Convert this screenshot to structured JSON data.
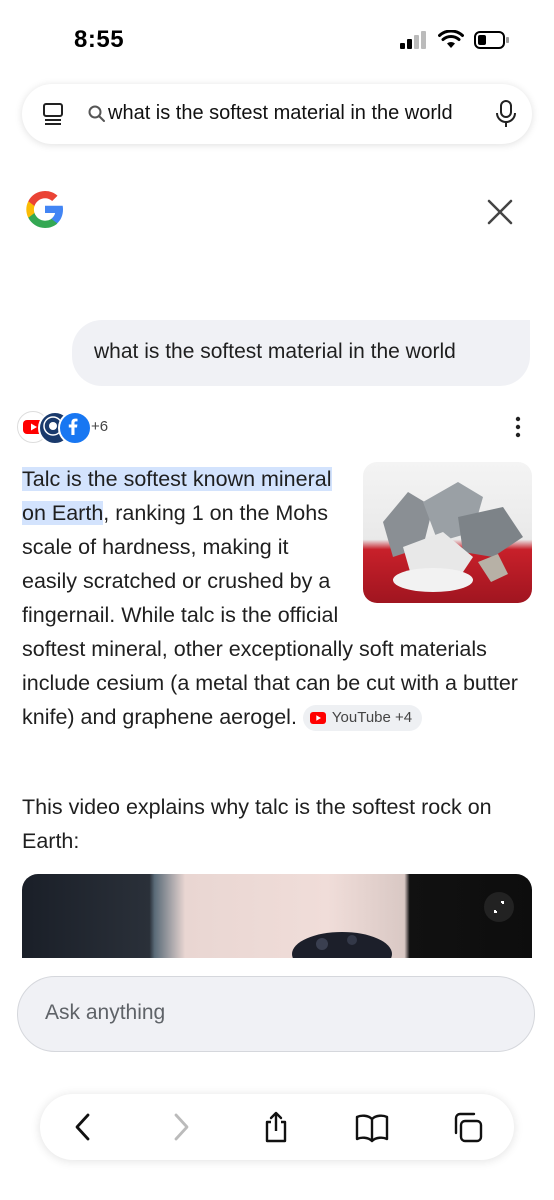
{
  "status": {
    "time": "8:55"
  },
  "urlbar": {
    "query": "what is the softest material in the world"
  },
  "conversation": {
    "user_query": "what is the softest material in the world",
    "sources_more": "+6",
    "answer": {
      "highlight": "Talc is the softest known mineral on Earth",
      "rest": ", ranking 1 on the Mohs scale of hardness, making it easily scratched or crushed by a fingernail. While talc is the official softest mineral, other exceptionally soft materials include cesium (a metal that can be cut with a butter knife) and graphene aerogel.",
      "chip_label": "YouTube +4"
    },
    "video_intro": "This video explains why talc is the softest rock on Earth:"
  },
  "ask": {
    "placeholder": "Ask anything"
  },
  "colors": {
    "highlight": "#d3e3fd",
    "youtube_red": "#ff0000",
    "facebook_blue": "#1877f2"
  },
  "icons": [
    "tabs-icon",
    "search-icon",
    "mic-icon",
    "google-logo",
    "close-icon",
    "youtube-icon",
    "guinness-icon",
    "facebook-icon",
    "more-vert-icon",
    "expand-icon",
    "back-icon",
    "forward-icon",
    "share-icon",
    "bookmarks-icon",
    "tabs-overview-icon"
  ]
}
